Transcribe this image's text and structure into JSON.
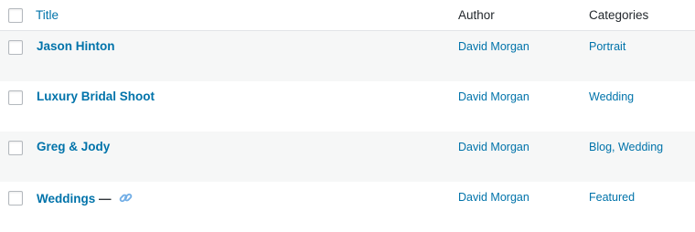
{
  "header": {
    "title_label": "Title",
    "author_label": "Author",
    "categories_label": "Categories"
  },
  "posts": [
    {
      "title": "Jason Hinton",
      "author": "David Morgan",
      "categories": [
        "Portrait"
      ]
    },
    {
      "title": "Luxury Bridal Shoot",
      "author": "David Morgan",
      "categories": [
        "Wedding"
      ]
    },
    {
      "title": "Greg & Jody",
      "author": "David Morgan",
      "categories": [
        "Blog",
        "Wedding"
      ],
      "category_separator": ", "
    },
    {
      "title": "Weddings",
      "title_suffix": " — ",
      "title_icon": "link-icon",
      "author": "David Morgan",
      "categories": [
        "Featured"
      ]
    }
  ],
  "colors": {
    "link": "#0073aa",
    "alt_row": "#f6f7f7",
    "header_text": "#23282d"
  }
}
